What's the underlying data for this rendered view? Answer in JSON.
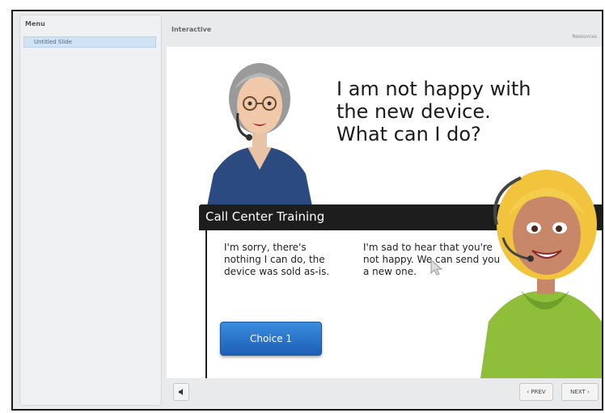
{
  "sidebar": {
    "menu_title": "Menu",
    "items": [
      {
        "label": "Untitled Slide",
        "selected": true
      }
    ]
  },
  "header": {
    "title": "Interactive",
    "resources_label": "Resources"
  },
  "slide": {
    "question_lines": [
      "I am not happy with",
      "the new device.",
      "What can I do?"
    ],
    "banner_title": "Call Center Training",
    "choices": [
      {
        "text": "I'm sorry, there's nothing I can do, the device was sold as-is."
      },
      {
        "text": "I'm sad to hear that you're not happy. We can send you a new one."
      }
    ],
    "choice_button_label": "Choice 1"
  },
  "footer": {
    "audio_icon": "speaker-icon",
    "prev_label": "‹ PREV",
    "next_label": "NEXT ›"
  },
  "colors": {
    "button_blue": "#2a73cc",
    "banner_black": "#1d1d1d",
    "menu_highlight": "#cfe3f5"
  }
}
